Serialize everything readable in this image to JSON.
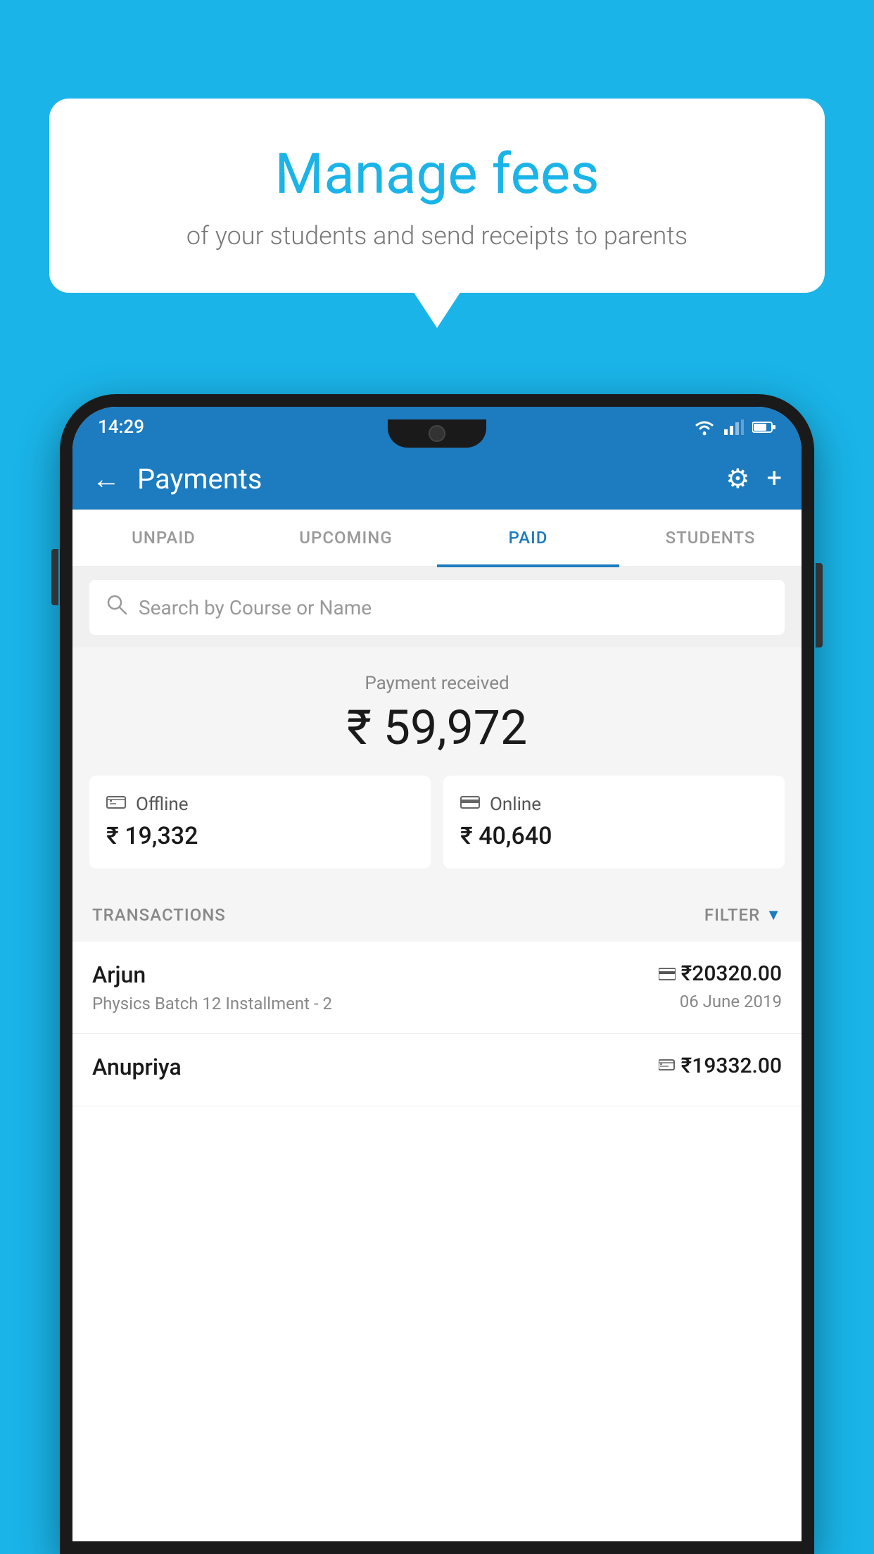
{
  "background_color": "#1ab4e8",
  "speech_bubble": {
    "title": "Manage fees",
    "subtitle": "of your students and send receipts to parents"
  },
  "status_bar": {
    "time": "14:29"
  },
  "app_header": {
    "title": "Payments",
    "back_label": "←",
    "gear_label": "⚙",
    "plus_label": "+"
  },
  "tabs": [
    {
      "label": "UNPAID",
      "active": false
    },
    {
      "label": "UPCOMING",
      "active": false
    },
    {
      "label": "PAID",
      "active": true
    },
    {
      "label": "STUDENTS",
      "active": false
    }
  ],
  "search": {
    "placeholder": "Search by Course or Name"
  },
  "payment_received": {
    "label": "Payment received",
    "amount": "₹ 59,972"
  },
  "payment_breakdown": {
    "offline": {
      "label": "Offline",
      "amount": "₹ 19,332"
    },
    "online": {
      "label": "Online",
      "amount": "₹ 40,640"
    }
  },
  "transactions": {
    "label": "TRANSACTIONS",
    "filter_label": "FILTER",
    "rows": [
      {
        "name": "Arjun",
        "description": "Physics Batch 12 Installment - 2",
        "amount": "₹20320.00",
        "date": "06 June 2019",
        "method_icon": "card"
      },
      {
        "name": "Anupriya",
        "description": "",
        "amount": "₹19332.00",
        "date": "",
        "method_icon": "cash"
      }
    ]
  }
}
